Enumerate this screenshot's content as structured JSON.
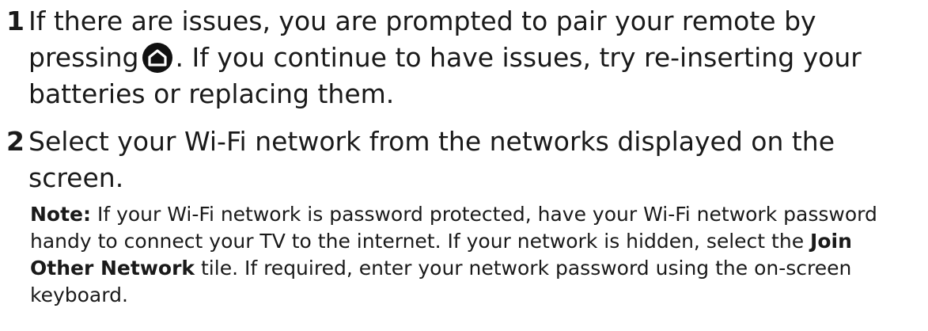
{
  "steps": [
    {
      "number": "1",
      "text_before_icon": "If there are issues, you are prompted to pair your remote by pressing",
      "icon": "home-icon",
      "text_after_icon": ". If you continue to have issues, try re-inserting your batteries or replacing them."
    },
    {
      "number": "2",
      "text": "Select your Wi-Fi network from the networks displayed on the screen.",
      "note": {
        "label": "Note:",
        "text_1": " If your Wi-Fi network is password protected, have your Wi-Fi network password handy to connect your TV to the internet. If your network is hidden, select the ",
        "emphasis": "Join Other Network",
        "text_2": " tile. If required, enter your network password using the on-screen keyboard."
      }
    }
  ]
}
